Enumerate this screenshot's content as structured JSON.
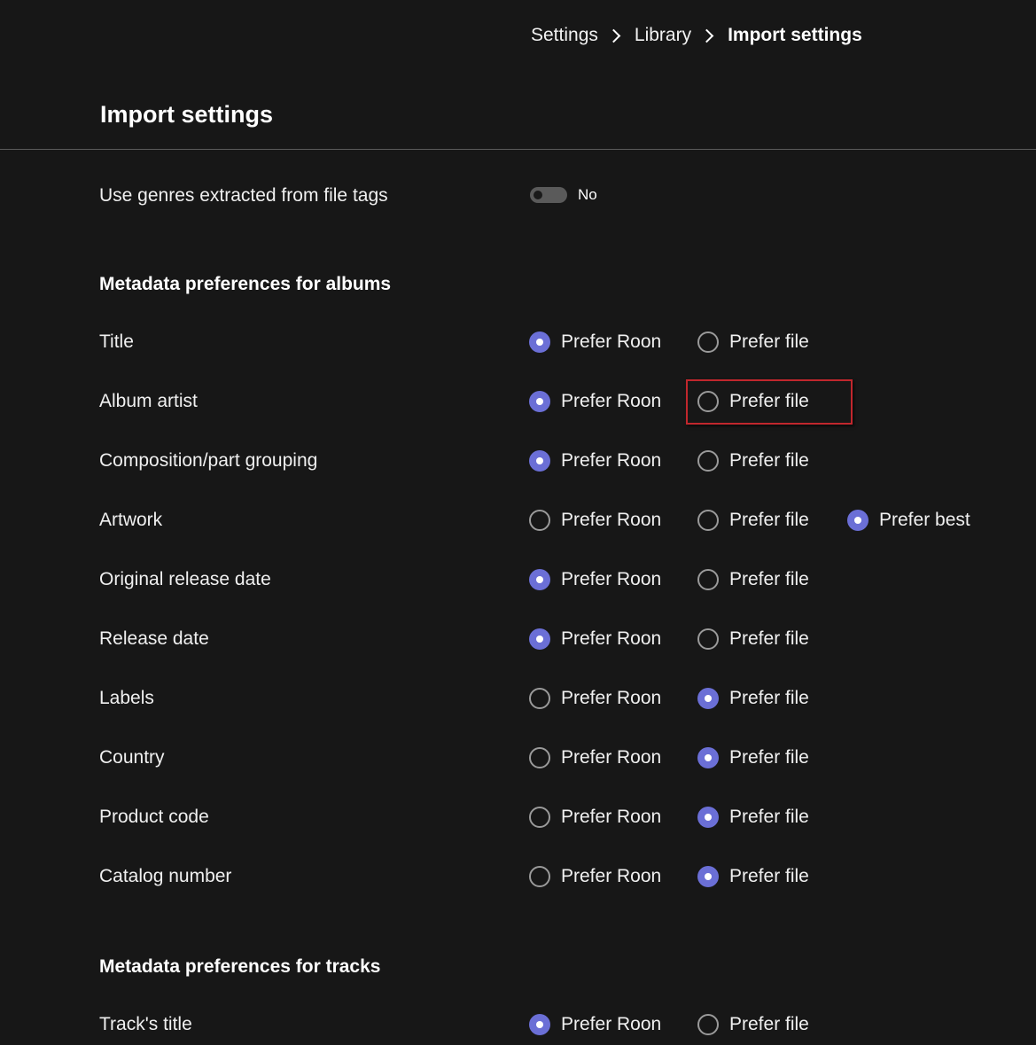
{
  "breadcrumb": {
    "items": [
      "Settings",
      "Library",
      "Import settings"
    ]
  },
  "page": {
    "title": "Import settings"
  },
  "genres": {
    "label": "Use genres extracted from file tags",
    "value": "No",
    "enabled": false
  },
  "albums": {
    "heading": "Metadata preferences for albums",
    "rows": [
      {
        "label": "Title",
        "options": [
          "Prefer Roon",
          "Prefer file"
        ],
        "selected": "Prefer Roon"
      },
      {
        "label": "Album artist",
        "options": [
          "Prefer Roon",
          "Prefer file"
        ],
        "selected": "Prefer Roon"
      },
      {
        "label": "Composition/part grouping",
        "options": [
          "Prefer Roon",
          "Prefer file"
        ],
        "selected": "Prefer Roon"
      },
      {
        "label": "Artwork",
        "options": [
          "Prefer Roon",
          "Prefer file",
          "Prefer best"
        ],
        "selected": "Prefer best"
      },
      {
        "label": "Original release date",
        "options": [
          "Prefer Roon",
          "Prefer file"
        ],
        "selected": "Prefer Roon"
      },
      {
        "label": "Release date",
        "options": [
          "Prefer Roon",
          "Prefer file"
        ],
        "selected": "Prefer Roon"
      },
      {
        "label": "Labels",
        "options": [
          "Prefer Roon",
          "Prefer file"
        ],
        "selected": "Prefer file"
      },
      {
        "label": "Country",
        "options": [
          "Prefer Roon",
          "Prefer file"
        ],
        "selected": "Prefer file"
      },
      {
        "label": "Product code",
        "options": [
          "Prefer Roon",
          "Prefer file"
        ],
        "selected": "Prefer file"
      },
      {
        "label": "Catalog number",
        "options": [
          "Prefer Roon",
          "Prefer file"
        ],
        "selected": "Prefer file"
      }
    ]
  },
  "tracks": {
    "heading": "Metadata preferences for tracks",
    "rows": [
      {
        "label": "Track's title",
        "options": [
          "Prefer Roon",
          "Prefer file"
        ],
        "selected": "Prefer Roon"
      }
    ]
  },
  "colors": {
    "background": "#171717",
    "accent": "#6b6fd6",
    "highlight": "#c1272d"
  }
}
